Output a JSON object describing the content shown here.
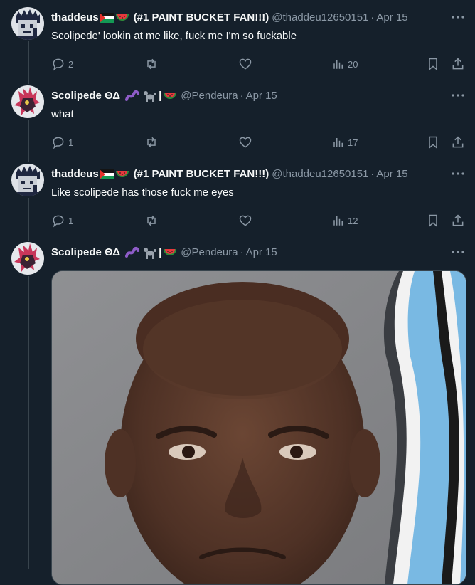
{
  "tweets": [
    {
      "name": "thaddeus",
      "name_suffix": "(#1 PAINT BUCKET FAN!!!)",
      "handle": "@thaddeu12650151",
      "date": "Apr 15",
      "text": "Scolipede' lookin at me like, fuck me I'm so fuckable",
      "replies": "2",
      "views": "20",
      "avatar_icon": "pixel-avatar-icon"
    },
    {
      "name": "Scolipede ΘΔ",
      "handle": "@Pendeura",
      "date": "Apr 15",
      "text": "what",
      "replies": "1",
      "views": "17",
      "avatar_icon": "scolipede-avatar-icon"
    },
    {
      "name": "thaddeus",
      "name_suffix": "(#1 PAINT BUCKET FAN!!!)",
      "handle": "@thaddeu12650151",
      "date": "Apr 15",
      "text": "Like scolipede has those fuck me eyes",
      "replies": "1",
      "views": "12",
      "avatar_icon": "pixel-avatar-icon"
    },
    {
      "name": "Scolipede ΘΔ",
      "handle": "@Pendeura",
      "date": "Apr 15",
      "avatar_icon": "scolipede-avatar-icon",
      "media": "portrait-photo"
    }
  ],
  "colors": {
    "background": "#15202b",
    "text": "#f7f9f9",
    "muted": "#8b98a5",
    "thread_line": "#38444d"
  }
}
